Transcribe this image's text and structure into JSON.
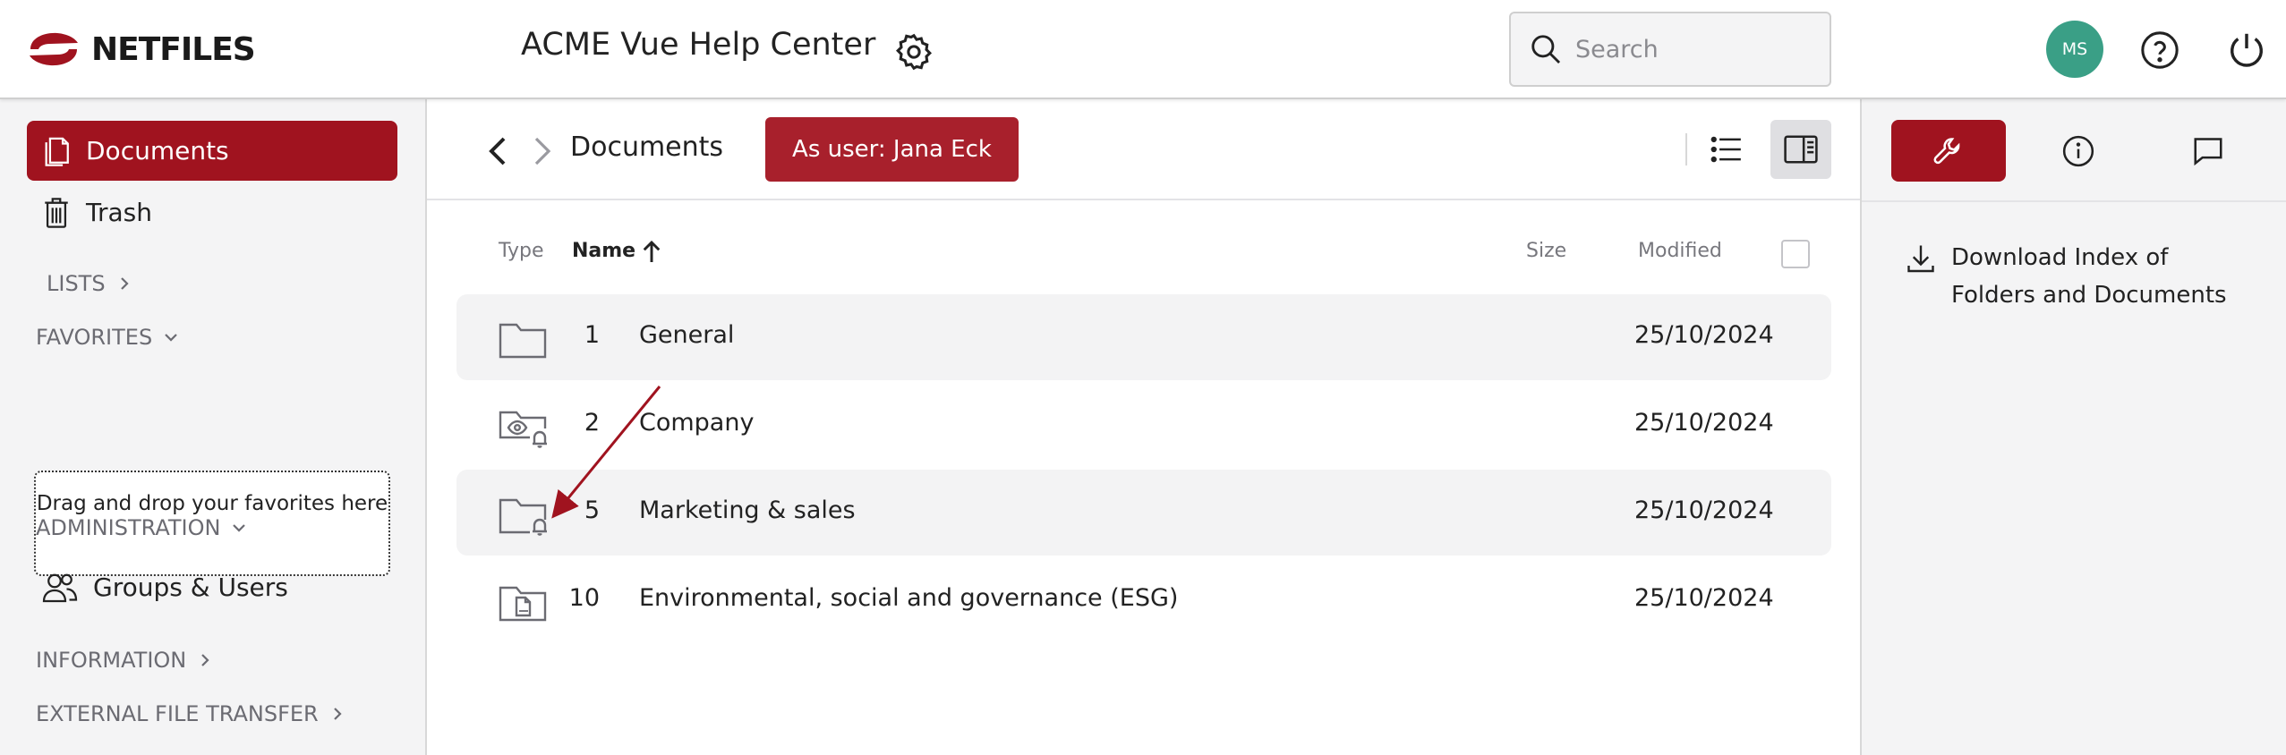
{
  "brand": {
    "logo_text": "NETFILES",
    "accent": "#a0131f"
  },
  "header": {
    "app_title": "ACME Vue Help Center",
    "search_placeholder": "Search",
    "avatar_initials": "MS"
  },
  "sidebar": {
    "documents_label": "Documents",
    "trash_label": "Trash",
    "lists_label": "LISTS",
    "favorites_label": "FAVORITES",
    "favorites_drop_text": "Drag and drop your favorites here",
    "administration_label": "ADMINISTRATION",
    "groups_users_label": "Groups & Users",
    "information_label": "INFORMATION",
    "external_transfer_label": "EXTERNAL FILE TRANSFER"
  },
  "toolbar": {
    "breadcrumb_title": "Documents",
    "as_user_label": "As user: Jana Eck"
  },
  "table": {
    "headers": {
      "type": "Type",
      "name": "Name",
      "size": "Size",
      "modified": "Modified"
    },
    "rows": [
      {
        "num": "1",
        "name": "General",
        "size": "",
        "modified": "25/10/2024",
        "icon": "folder-icon"
      },
      {
        "num": "2",
        "name": "Company",
        "size": "",
        "modified": "25/10/2024",
        "icon": "folder-watch-bell-icon"
      },
      {
        "num": "5",
        "name": "Marketing & sales",
        "size": "",
        "modified": "25/10/2024",
        "icon": "folder-bell-icon"
      },
      {
        "num": "10",
        "name": "Environmental, social and governance (ESG)",
        "size": "",
        "modified": "25/10/2024",
        "icon": "folder-pdf-icon"
      }
    ]
  },
  "right_panel": {
    "download_label": "Download Index of Folders and Documents"
  }
}
